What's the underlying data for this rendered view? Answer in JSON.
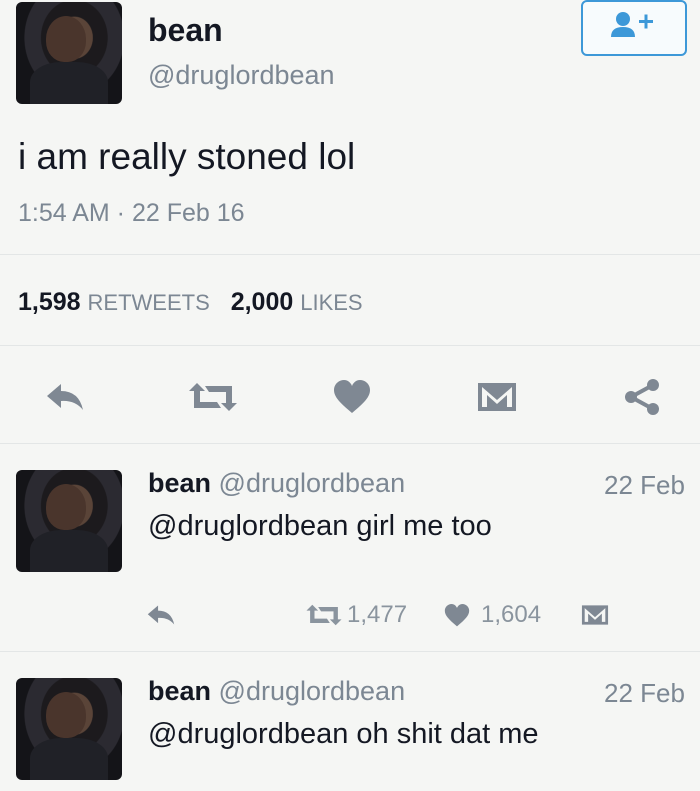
{
  "main_tweet": {
    "name": "bean",
    "handle": "@druglordbean",
    "text": "i am really stoned lol",
    "timestamp": "1:54 AM · 22 Feb 16",
    "retweets_count": "1,598",
    "retweets_label": "RETWEETS",
    "likes_count": "2,000",
    "likes_label": "LIKES"
  },
  "replies": [
    {
      "name": "bean",
      "handle": "@druglordbean",
      "date": "22 Feb",
      "text": "@druglordbean girl me too",
      "retweets": "1,477",
      "likes": "1,604"
    },
    {
      "name": "bean",
      "handle": "@druglordbean",
      "date": "22 Feb",
      "text": "@druglordbean oh shit dat me"
    }
  ],
  "icons": {
    "follow": "follow-user-icon",
    "reply": "reply-icon",
    "retweet": "retweet-icon",
    "like": "heart-icon",
    "dm": "envelope-icon",
    "share": "share-icon"
  },
  "colors": {
    "accent": "#3d98d8",
    "icon_gray": "#7f8893",
    "text": "#141823",
    "muted": "#7c8793"
  }
}
